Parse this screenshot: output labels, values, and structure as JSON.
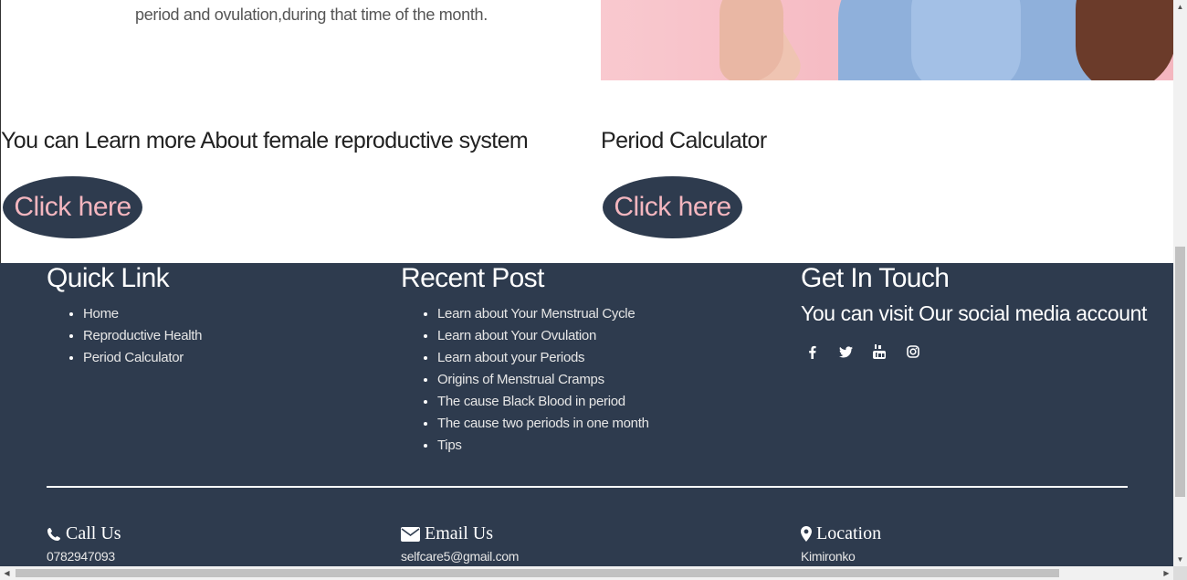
{
  "intro": {
    "text": "period and ovulation,during that time of the month."
  },
  "sections": {
    "learn_title": "You can Learn more About female reproductive system",
    "learn_button": "Click here",
    "period_title": "Period Calculator",
    "period_button": "Click here"
  },
  "footer": {
    "quick_link": {
      "title": "Quick Link",
      "items": [
        "Home",
        "Reproductive Health",
        "Period Calculator"
      ]
    },
    "recent_post": {
      "title": "Recent Post",
      "items": [
        "Learn about Your Menstrual Cycle",
        "Learn about Your Ovulation",
        "Learn about your Periods",
        "Origins of Menstrual Cramps",
        "The cause Black Blood in period",
        "The cause two periods in one month",
        "Tips"
      ]
    },
    "get_in_touch": {
      "title": "Get In Touch",
      "subtitle": "You can visit Our social media account",
      "social_icons": [
        "facebook-icon",
        "twitter-icon",
        "youtube-icon",
        "instagram-icon"
      ]
    },
    "contact": {
      "call": {
        "label": "Call Us",
        "value": "0782947093"
      },
      "email": {
        "label": "Email Us",
        "value": "selfcare5@gmail.com"
      },
      "location": {
        "label": "Location",
        "value": "Kimironko"
      }
    }
  },
  "colors": {
    "footer_bg": "#2e3b4e",
    "button_bg": "#2e3b4e",
    "button_text": "#f4b6bf"
  }
}
